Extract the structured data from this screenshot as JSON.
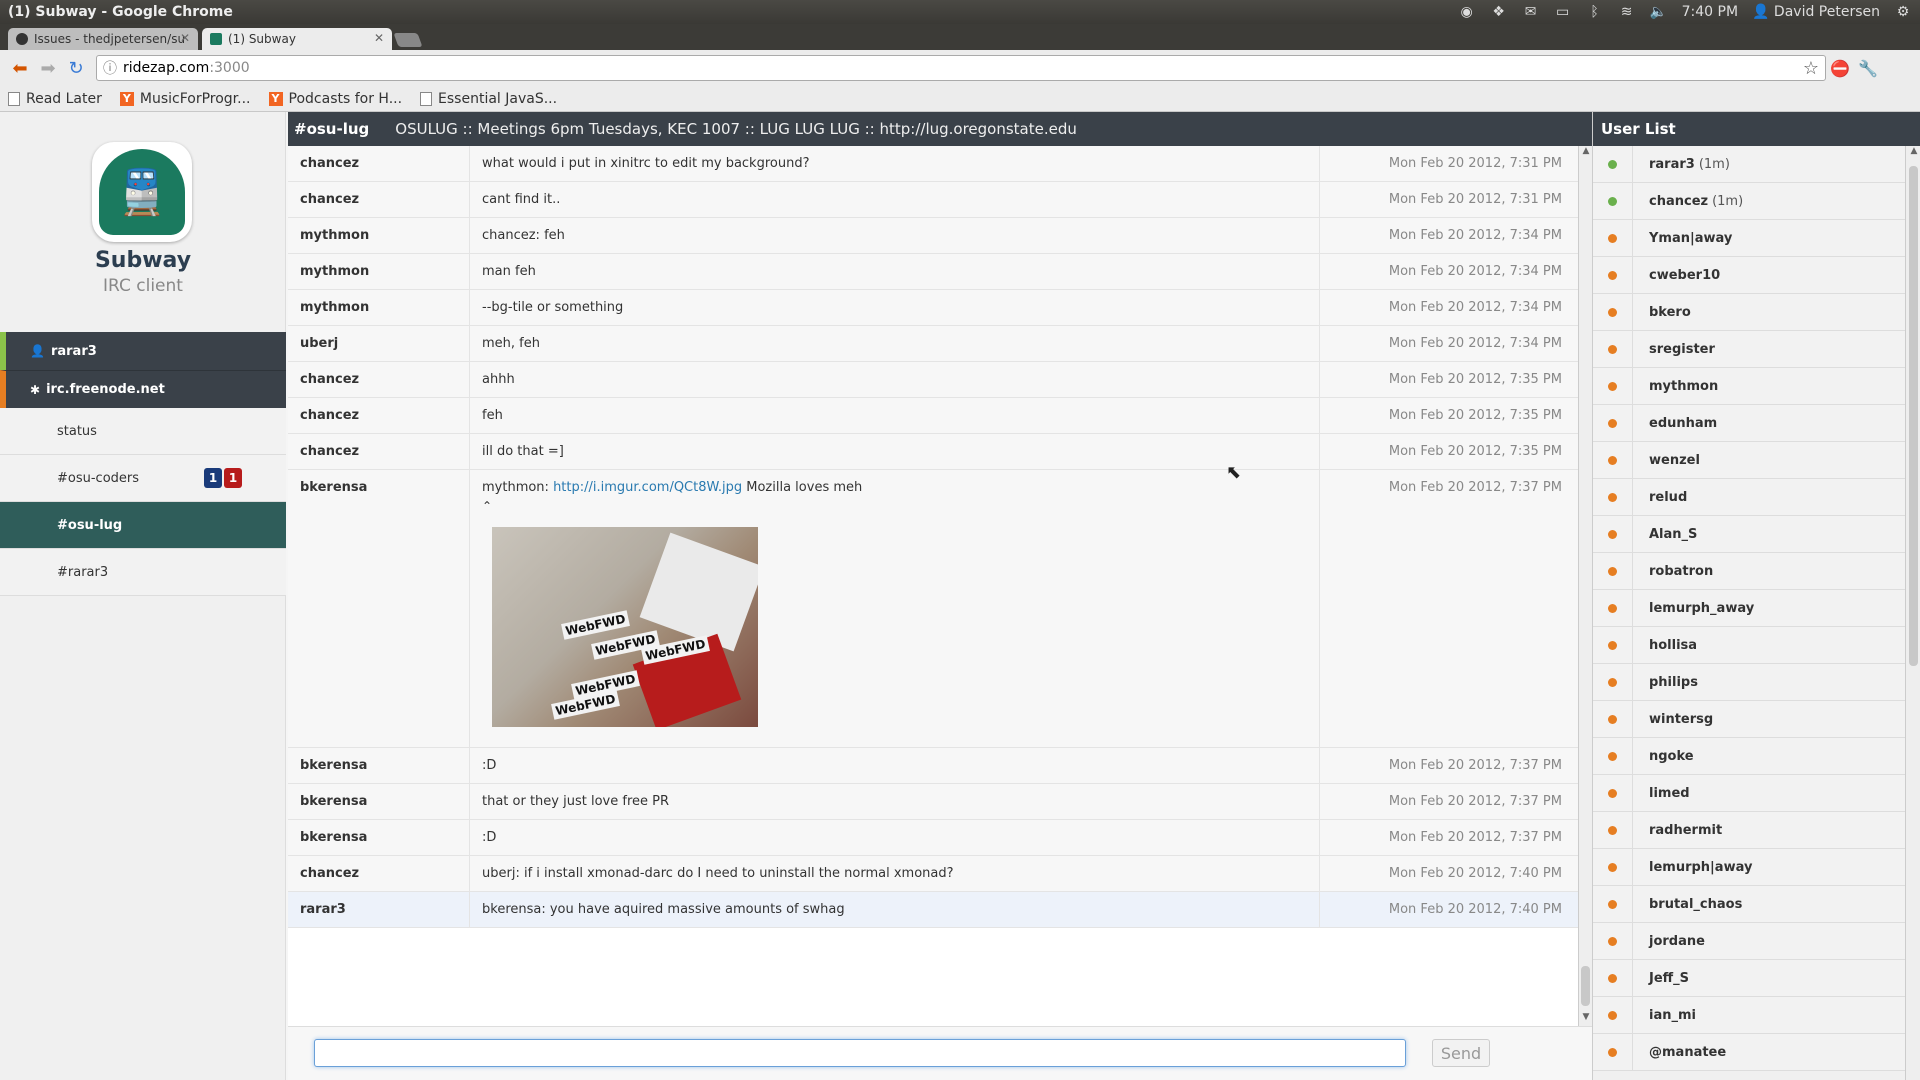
{
  "window": {
    "title": "(1) Subway - Google Chrome",
    "tray_time": "7:40 PM",
    "tray_user": "David Petersen"
  },
  "tabs": [
    {
      "label": "Issues - thedjpetersen/sub"
    },
    {
      "label": "(1) Subway"
    }
  ],
  "address": {
    "host": "ridezap.com",
    "port": ":3000"
  },
  "bookmarks": [
    {
      "label": "Read Later",
      "icon": "page-icon"
    },
    {
      "label": "MusicForProgr...",
      "icon": "y-combinator-icon"
    },
    {
      "label": "Podcasts for H...",
      "icon": "y-combinator-icon"
    },
    {
      "label": "Essential JavaS...",
      "icon": "page-icon"
    }
  ],
  "app": {
    "name": "Subway",
    "subtitle": "IRC client"
  },
  "nav": {
    "user": "rarar3",
    "server": "irc.freenode.net",
    "channels": [
      {
        "label": "status",
        "badges": []
      },
      {
        "label": "#osu-coders",
        "badges": [
          "1",
          "1"
        ]
      },
      {
        "label": "#osu-lug",
        "badges": [],
        "active": true
      },
      {
        "label": "#rarar3",
        "badges": []
      }
    ]
  },
  "topic": {
    "channel": "#osu-lug",
    "text": "OSULUG :: Meetings 6pm Tuesdays, KEC 1007 :: LUG LUG LUG :: http://lug.oregonstate.edu"
  },
  "messages": [
    {
      "nick": "chancez",
      "text": "what would i put in xinitrc to edit my background?",
      "time": "Mon Feb 20 2012, 7:31 PM"
    },
    {
      "nick": "chancez",
      "text": "cant find it..",
      "time": "Mon Feb 20 2012, 7:31 PM"
    },
    {
      "nick": "mythmon",
      "text": "chancez: feh",
      "time": "Mon Feb 20 2012, 7:34 PM"
    },
    {
      "nick": "mythmon",
      "text": "man feh",
      "time": "Mon Feb 20 2012, 7:34 PM"
    },
    {
      "nick": "mythmon",
      "text": "--bg-tile or something",
      "time": "Mon Feb 20 2012, 7:34 PM"
    },
    {
      "nick": "uberj",
      "text": "meh, feh",
      "time": "Mon Feb 20 2012, 7:34 PM"
    },
    {
      "nick": "chancez",
      "text": "ahhh",
      "time": "Mon Feb 20 2012, 7:35 PM"
    },
    {
      "nick": "chancez",
      "text": "feh",
      "time": "Mon Feb 20 2012, 7:35 PM"
    },
    {
      "nick": "chancez",
      "text": "ill do that =]",
      "time": "Mon Feb 20 2012, 7:35 PM"
    },
    {
      "nick": "bkerensa",
      "text_pre": "mythmon: ",
      "link": "http://i.imgur.com/QCt8W.jpg",
      "text_post": " Mozilla loves meh",
      "time": "Mon Feb 20 2012, 7:37 PM",
      "image": true,
      "image_labels": [
        "WebFWD",
        "WebFWD",
        "WebFWD",
        "WebFWD",
        "WebFWD"
      ]
    },
    {
      "nick": "bkerensa",
      "text": ":D",
      "time": "Mon Feb 20 2012, 7:37 PM"
    },
    {
      "nick": "bkerensa",
      "text": "that or they just love free PR",
      "time": "Mon Feb 20 2012, 7:37 PM"
    },
    {
      "nick": "bkerensa",
      "text": ":D",
      "time": "Mon Feb 20 2012, 7:37 PM"
    },
    {
      "nick": "chancez",
      "text": "uberj: if i install xmonad-darc do I need to uninstall the normal xmonad?",
      "time": "Mon Feb 20 2012, 7:40 PM"
    },
    {
      "nick": "rarar3",
      "text": "bkerensa: you have aquired massive amounts of swhag",
      "time": "Mon Feb 20 2012, 7:40 PM",
      "highlight": true
    }
  ],
  "input": {
    "value": "",
    "send_label": "Send"
  },
  "userlist": {
    "title": "User List",
    "users": [
      {
        "name": "rarar3",
        "idle": "(1m)",
        "status": "online"
      },
      {
        "name": "chancez",
        "idle": "(1m)",
        "status": "online"
      },
      {
        "name": "Yman|away",
        "status": "away"
      },
      {
        "name": "cweber10",
        "status": "away"
      },
      {
        "name": "bkero",
        "status": "away"
      },
      {
        "name": "sregister",
        "status": "away"
      },
      {
        "name": "mythmon",
        "status": "away"
      },
      {
        "name": "edunham",
        "status": "away"
      },
      {
        "name": "wenzel",
        "status": "away"
      },
      {
        "name": "relud",
        "status": "away"
      },
      {
        "name": "Alan_S",
        "status": "away"
      },
      {
        "name": "robatron",
        "status": "away"
      },
      {
        "name": "lemurph_away",
        "status": "away"
      },
      {
        "name": "hollisa",
        "status": "away"
      },
      {
        "name": "philips",
        "status": "away"
      },
      {
        "name": "wintersg",
        "status": "away"
      },
      {
        "name": "ngoke",
        "status": "away"
      },
      {
        "name": "limed",
        "status": "away"
      },
      {
        "name": "radhermit",
        "status": "away"
      },
      {
        "name": "lemurph|away",
        "status": "away"
      },
      {
        "name": "brutal_chaos",
        "status": "away"
      },
      {
        "name": "jordane",
        "status": "away"
      },
      {
        "name": "Jeff_S",
        "status": "away"
      },
      {
        "name": "ian_mi",
        "status": "away"
      },
      {
        "name": "@manatee",
        "status": "away"
      }
    ]
  },
  "colors": {
    "online": "#6ab04c",
    "away": "#e67e22",
    "header": "#3a4149",
    "active_channel": "#2f5d5a"
  }
}
